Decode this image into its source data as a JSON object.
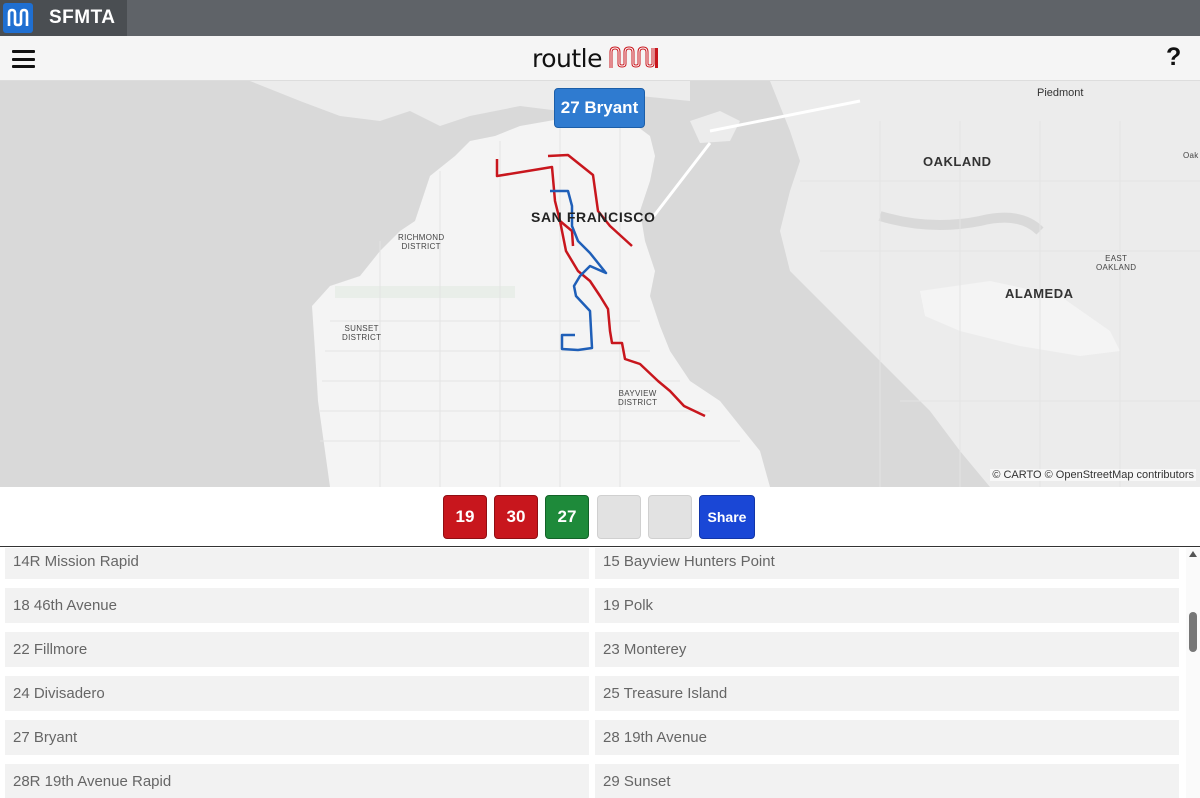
{
  "window": {
    "app_title": "SFMTA"
  },
  "header": {
    "brand_word": "routle",
    "brand_logo": "muni-logo",
    "help_label": "?"
  },
  "map": {
    "selected_route": "27 Bryant",
    "labels": {
      "piedmont": "Piedmont",
      "oakland": "OAKLAND",
      "oak_edge": "Oak",
      "san_francisco": "SAN FRANCISCO",
      "richmond": "RICHMOND\nDISTRICT",
      "sunset": "SUNSET\nDISTRICT",
      "east_oakland": "EAST\nOAKLAND",
      "alameda": "ALAMEDA",
      "bayview": "BAYVIEW\nDISTRICT"
    },
    "attribution": "© CARTO © OpenStreetMap contributors",
    "colors": {
      "water": "#d9d9d9",
      "land": "#f4f4f4",
      "route_red": "#c8161d",
      "route_blue": "#1f5fb8"
    }
  },
  "guesses": {
    "slots": [
      {
        "label": "19",
        "state": "wrong"
      },
      {
        "label": "30",
        "state": "wrong"
      },
      {
        "label": "27",
        "state": "correct"
      },
      {
        "label": "",
        "state": "empty"
      },
      {
        "label": "",
        "state": "empty"
      }
    ],
    "share_label": "Share"
  },
  "routes": [
    "14R Mission Rapid",
    "15 Bayview Hunters Point",
    "18 46th Avenue",
    "19 Polk",
    "22 Fillmore",
    "23 Monterey",
    "24 Divisadero",
    "25 Treasure Island",
    "27 Bryant",
    "28 19th Avenue",
    "28R 19th Avenue Rapid",
    "29 Sunset"
  ]
}
